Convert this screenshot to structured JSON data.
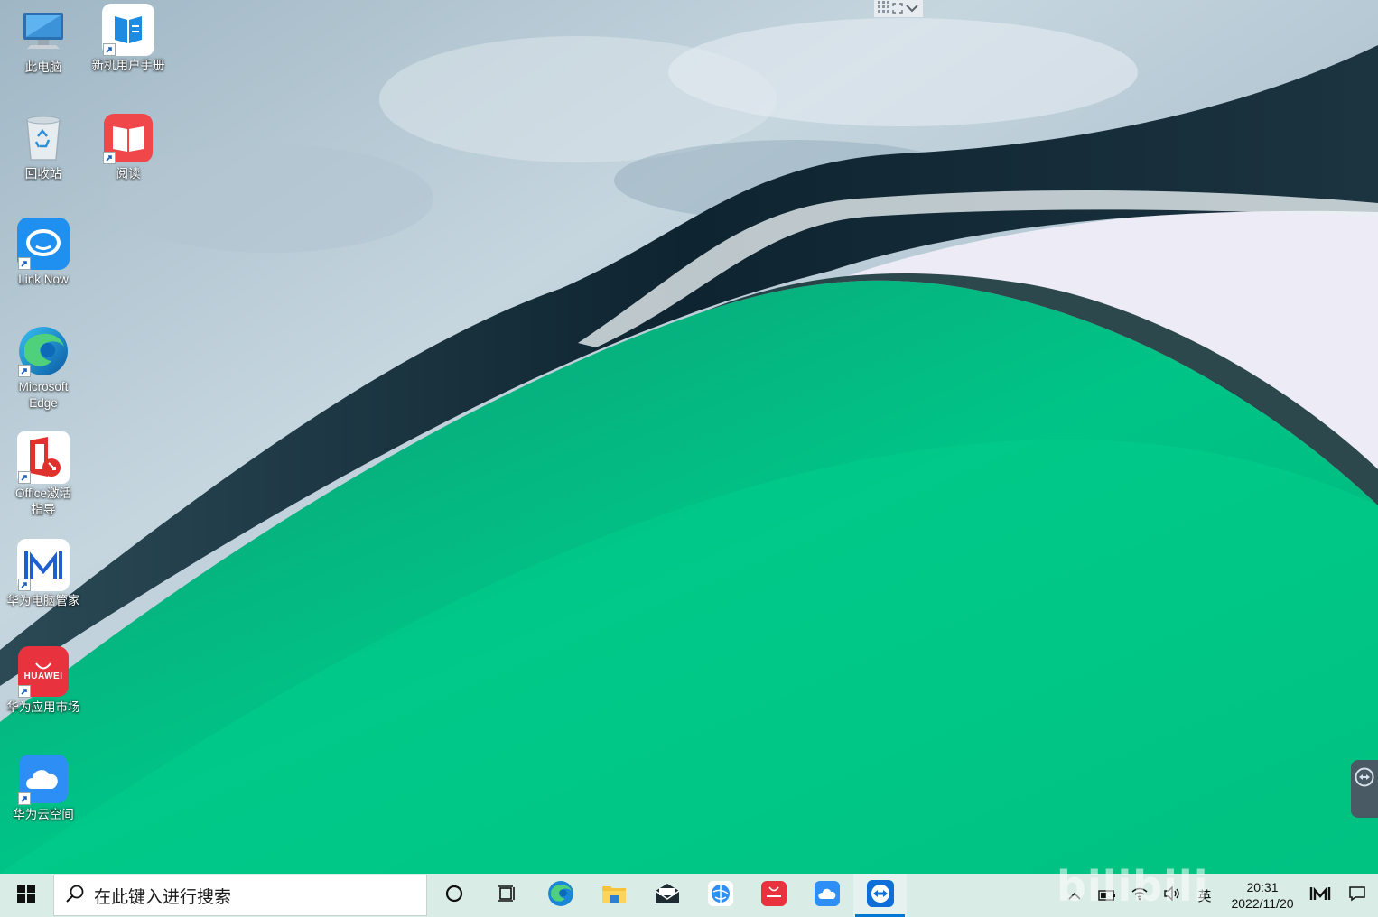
{
  "desktop": {
    "icons": [
      {
        "label": "此电脑",
        "icon": "computer-icon"
      },
      {
        "label": "新机用户手册",
        "icon": "user-manual-icon"
      },
      {
        "label": "回收站",
        "icon": "recycle-bin-icon"
      },
      {
        "label": "阅读",
        "icon": "reader-icon"
      },
      {
        "label": "Link Now",
        "icon": "link-now-icon"
      },
      {
        "label": "Microsoft\nEdge",
        "icon": "edge-icon"
      },
      {
        "label": "Office激活\n指导",
        "icon": "office-icon"
      },
      {
        "label": "华为电脑管家",
        "icon": "pc-manager-icon"
      },
      {
        "label": "华为应用市场",
        "icon": "appgallery-icon"
      },
      {
        "label": "华为云空间",
        "icon": "cloud-icon"
      }
    ],
    "appgallery_badge": "HUAWEI"
  },
  "taskbar": {
    "search_placeholder": "在此键入进行搜索",
    "pinned": [
      "cortana-icon",
      "task-view-icon",
      "edge-icon",
      "file-explorer-icon",
      "mail-icon",
      "browser-icon",
      "appgallery-icon",
      "cloud-icon",
      "teamviewer-icon"
    ],
    "active_app": "teamviewer-icon",
    "tray": {
      "ime": "英",
      "time": "20:31",
      "date": "2022/11/20"
    }
  },
  "watermark": "bilibili 1835069",
  "colors": {
    "taskbar_bg": "#d9ece6",
    "accent": "#0078d4",
    "wallpaper_green": "#00b77a"
  }
}
